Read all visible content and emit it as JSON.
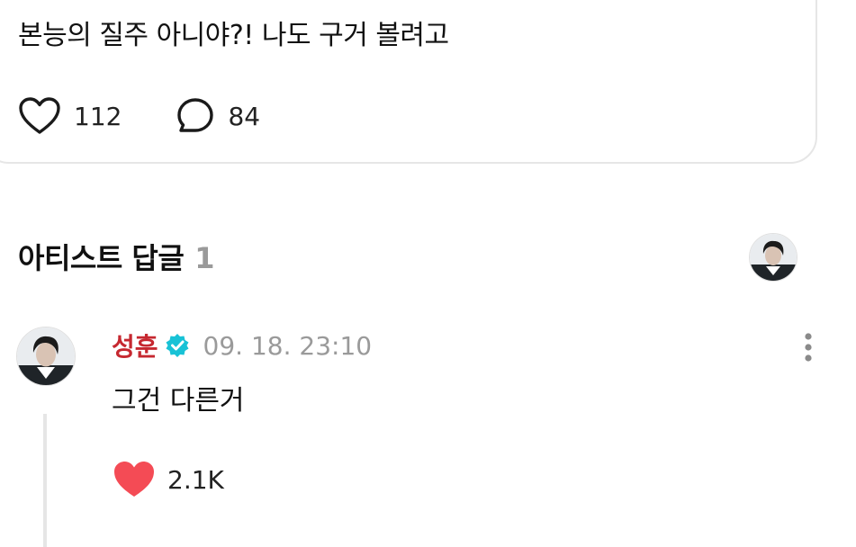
{
  "post": {
    "text": "본능의 질주 아니야?! 나도 구거 볼려고",
    "likes": "112",
    "comments": "84"
  },
  "replies_section": {
    "title": "아티스트 답글",
    "count": "1"
  },
  "reply": {
    "author": "성훈",
    "timestamp": "09. 18. 23:10",
    "text": "그건 다른거",
    "likes": "2.1K",
    "author_color": "#c62830",
    "verified_color": "#18c2d6",
    "like_color": "#f44b55"
  }
}
